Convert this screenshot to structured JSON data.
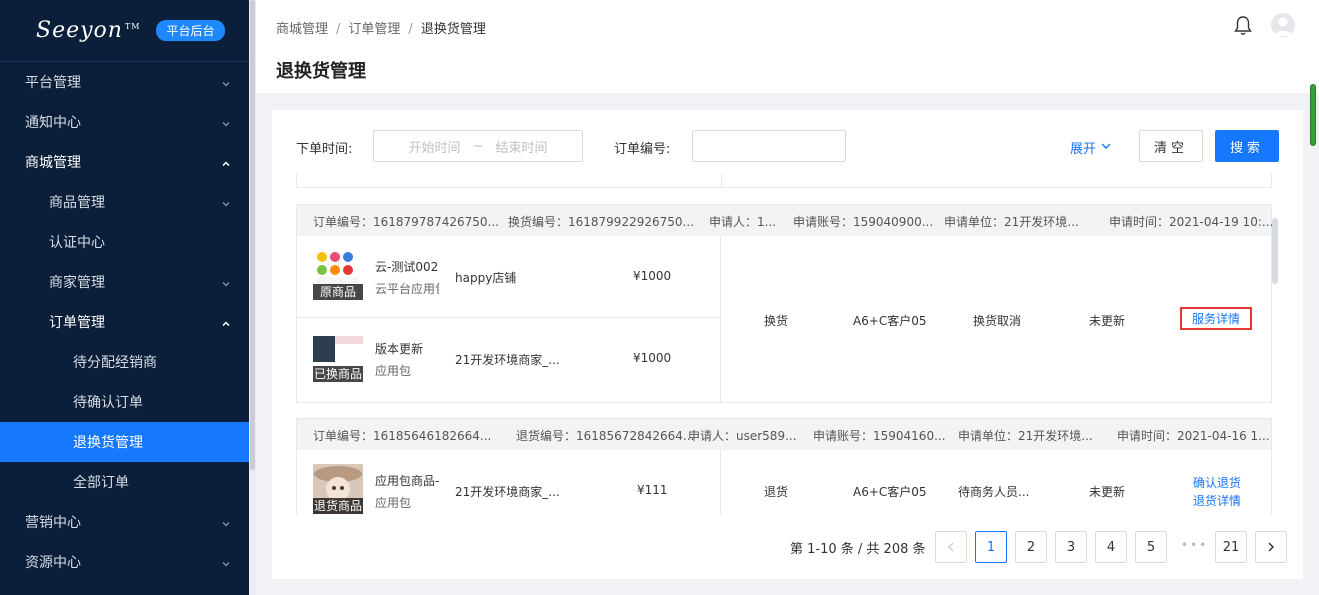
{
  "sidebar": {
    "logo": "Seeyon",
    "logo_tm": "TM",
    "badge": "平台后台",
    "items": [
      {
        "label": "平台管理"
      },
      {
        "label": "通知中心"
      },
      {
        "label": "商城管理"
      },
      {
        "label": "商品管理"
      },
      {
        "label": "认证中心"
      },
      {
        "label": "商家管理"
      },
      {
        "label": "订单管理"
      },
      {
        "label": "待分配经销商"
      },
      {
        "label": "待确认订单"
      },
      {
        "label": "退换货管理"
      },
      {
        "label": "全部订单"
      },
      {
        "label": "营销中心"
      },
      {
        "label": "资源中心"
      }
    ]
  },
  "header": {
    "breadcrumb": [
      "商城管理",
      "订单管理",
      "退换货管理"
    ],
    "separator": "/",
    "title": "退换货管理"
  },
  "filters": {
    "time_label": "下单时间:",
    "start_placeholder": "开始时间",
    "range_sep": "~",
    "end_placeholder": "结束时间",
    "order_label": "订单编号:",
    "order_value": "",
    "expand": "展开",
    "clear": "清空",
    "search": "搜索"
  },
  "orders": [
    {
      "order_no": "订单编号：161879787426750...",
      "exchange_no": "换货编号：161879922926750...",
      "applicant": "申请人：1...",
      "account": "申请账号：159040900...",
      "unit": "申请单位：21开发环境...",
      "time": "申请时间：2021-04-19 10:...",
      "goods": [
        {
          "name": "云-测试002",
          "type": "云平台应用包",
          "shop": "happy店铺",
          "price": "¥1000",
          "tag": "原商品"
        },
        {
          "name": "版本更新",
          "type": "应用包",
          "shop": "21开发环境商家_...",
          "price": "¥1000",
          "tag": "已换商品"
        }
      ],
      "service_type": "换货",
      "customer": "A6+C客户05",
      "status": "换货取消",
      "update": "未更新",
      "actions": [
        "服务详情"
      ]
    },
    {
      "order_no": "订单编号：16185646182664...",
      "exchange_no": "退货编号：16185672842664...",
      "applicant": "申请人：user589...",
      "account": "申请账号：15904160...",
      "unit": "申请单位：21开发环境...",
      "time": "申请时间：2021-04-16 1...",
      "goods": [
        {
          "name": "应用包商品-",
          "type": "应用包",
          "shop": "21开发环境商家_...",
          "price": "¥111",
          "tag": "退货商品"
        }
      ],
      "service_type": "退货",
      "customer": "A6+C客户05",
      "status": "待商务人员...",
      "update": "未更新",
      "actions": [
        "确认退货",
        "退货详情"
      ]
    }
  ],
  "pagination": {
    "total_text": "第 1-10 条 / 共 208 条",
    "pages": [
      "1",
      "2",
      "3",
      "4",
      "5"
    ],
    "dots": "•••",
    "last": "21",
    "current": "1"
  },
  "colors": {
    "sidebar_bg": "#0b1f3b",
    "accent": "#1677ff",
    "highlight_border": "#e53935"
  }
}
